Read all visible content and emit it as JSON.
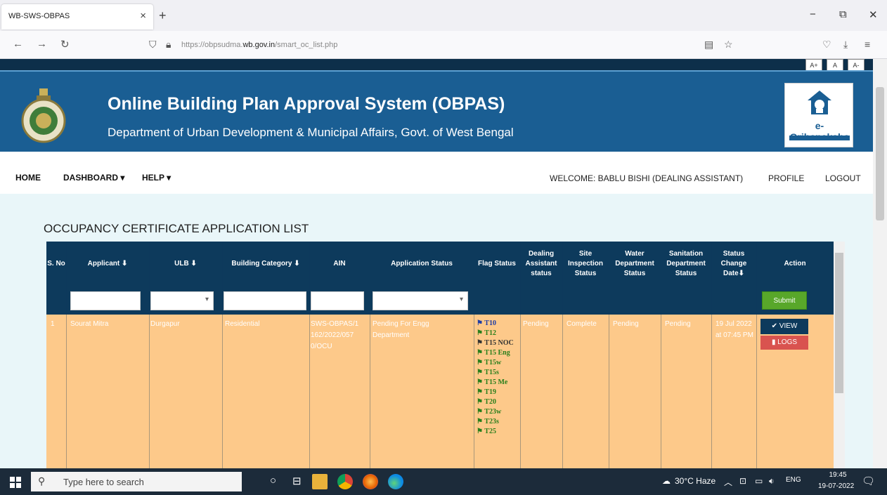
{
  "browser": {
    "tab_title": "WB-SWS-OBPAS",
    "tab_close": "×",
    "new_tab": "+",
    "url_prefix": "https://obpsudma.",
    "url_domain": "wb.gov.in",
    "url_path": "/smart_oc_list.php",
    "win_min": "−",
    "win_max": "⧉",
    "win_close": "✕"
  },
  "page": {
    "font_buttons": [
      "A+",
      "A",
      "A-"
    ],
    "title": "Online Building Plan Approval System (OBPAS)",
    "subtitle": "Department of Urban Development & Municipal Affairs, Govt. of West Bengal",
    "logo_text": "e-Grihanaksha",
    "menu": {
      "home": "HOME",
      "dashboard": "DASHBOARD ▾",
      "help": "HELP ▾",
      "welcome": "WELCOME: BABLU BISHI (DEALING ASSISTANT)",
      "profile": "PROFILE",
      "logout": "LOGOUT"
    },
    "list_title": "OCCUPANCY CERTIFICATE APPLICATION LIST",
    "columns": [
      "S. No",
      "Applicant ⬇",
      "ULB ⬇",
      "Building Category ⬇",
      "AIN",
      "Application Status",
      "Flag Status",
      "Dealing Assistant status",
      "Site Inspection Status",
      "Water Department Status",
      "Sanitation Department Status",
      "Status Change Date⬇",
      "Action"
    ],
    "submit_label": "Submit",
    "row": {
      "sno": "1",
      "applicant": "Sourat Mitra",
      "ulb": "Durgapur",
      "category": "Residential",
      "ain": "SWS-OBPAS/1 162/2022/057 0/OCU",
      "app_status": "Pending For Engg Department",
      "dealing_status": "Pending",
      "site_status": "Complete",
      "water_status": "Pending",
      "sanitation_status": "Pending",
      "change_date": "19 Jul 2022 at 07:45 PM",
      "view_label": "✔ VIEW",
      "logs_label": "▮ LOGS"
    },
    "flags": [
      "T10",
      "T12",
      "T15 NOC",
      "T15 Eng",
      "T15w",
      "T15s",
      "T15 Me",
      "T19",
      "T20",
      "T23w",
      "T23s",
      "T25"
    ]
  },
  "taskbar": {
    "search_placeholder": "Type here to search",
    "weather": "30°C Haze",
    "lang": "ENG",
    "time": "19:45",
    "date": "19-07-2022"
  }
}
